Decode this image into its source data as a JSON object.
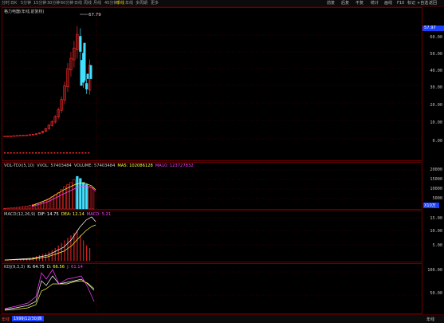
{
  "toolbar": {
    "items": [
      "分时",
      "日K",
      "5分钟",
      "15分钟",
      "30分钟",
      "60分钟",
      "日线",
      "周线",
      "月线",
      "45分钟",
      "季线",
      "年线",
      "多周期",
      "更多"
    ],
    "active_index": 10,
    "right_items": [
      "前复",
      "后复",
      "不复",
      "统计",
      "画线",
      "F10",
      "标记",
      "+自选",
      "返回"
    ]
  },
  "main": {
    "title": "格力电器(年线,前复权)",
    "current_price": "57.97",
    "high_label": "67.79",
    "yticks": [
      "60.00",
      "50.00",
      "40.00",
      "30.00",
      "20.00",
      "10.00",
      "0.00"
    ]
  },
  "vol": {
    "legend_name": "VOL-TDX(5,10)",
    "legend_vvol": "VVOL: 57403484",
    "legend_volume": "VOLUME: 57403484",
    "legend_ma5": "MA5: 102086128",
    "legend_ma10": "MA10: 123727832",
    "yticks": [
      "20000",
      "15000",
      "10000",
      "5000"
    ],
    "unit": "X10万"
  },
  "macd": {
    "legend_name": "MACD(12,26,9)",
    "legend_dif": "DIF: 14.75",
    "legend_dea": "DEA: 12.14",
    "legend_macd": "MACD: 5.21",
    "yticks": [
      "15.00",
      "10.00",
      "5.00"
    ]
  },
  "kdj": {
    "legend_name": "KDJ(9,3,3)",
    "legend_k": "K: 64.75",
    "legend_d": "D: 66.56",
    "legend_j": "J: 61.14",
    "yticks": [
      "100.00",
      "50.00"
    ]
  },
  "bottom": {
    "left_label": "年线",
    "date": "1999/12/30/四",
    "right_label": "年线"
  },
  "colors": {
    "up": "#ff2a2a",
    "down": "#40e0ff",
    "dif": "#ffffff",
    "dea": "#ffff40",
    "j": "#ff40ff",
    "border": "#6b0000"
  }
}
